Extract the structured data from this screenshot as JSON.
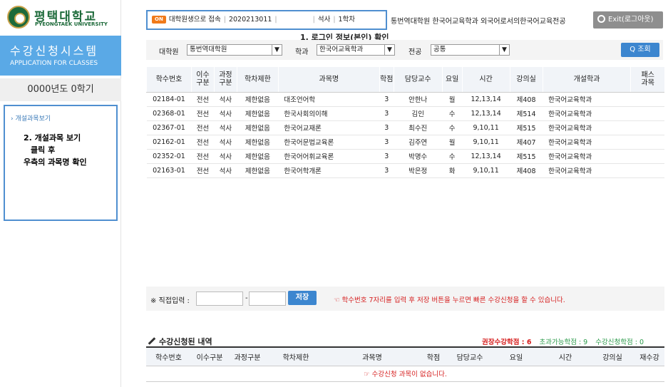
{
  "logo": {
    "korean": "평택대학교",
    "english": "PYEONGTAEK UNIVERSITY"
  },
  "sidebar": {
    "system_title": "수강신청시스템",
    "system_subtitle": "APPLICATION FOR CLASSES",
    "semester": "0000년도 0학기",
    "menu_item": "› 개설과목보기",
    "callout": [
      "2. 개설과목 보기",
      "클릭 후",
      "우측의 과목명 확인"
    ]
  },
  "header": {
    "on_badge": "ON",
    "access_type": "대학원생으로 접속",
    "student_id": "2020213011",
    "degree": "석사",
    "grade": "1학차",
    "department_line": "통번역대학원 한국어교육학과 외국어로서의한국어교육전공",
    "exit_label": "Exit(로그아웃)",
    "callout": "1. 로그인 정보(본인) 확인"
  },
  "filter": {
    "graduate_label": "대학원",
    "graduate_value": "통번역대학원",
    "dept_label": "학과",
    "dept_value": "한국어교육학과",
    "major_label": "전공",
    "major_value": "공통",
    "search_label": "Q 조회"
  },
  "table": {
    "headers": [
      "학수번호",
      "이수\n구분",
      "과정\n구분",
      "학차제한",
      "과목명",
      "학점",
      "담당교수",
      "요일",
      "시간",
      "강의실",
      "개설학과",
      "패스\n과목"
    ],
    "rows": [
      [
        "02184-01",
        "전선",
        "석사",
        "제한없음",
        "대조언어학",
        "3",
        "안한나",
        "월",
        "12,13,14",
        "제408",
        "한국어교육학과",
        ""
      ],
      [
        "02368-01",
        "전선",
        "석사",
        "제한없음",
        "한국사회의이해",
        "3",
        "김인",
        "수",
        "12,13,14",
        "제514",
        "한국어교육학과",
        ""
      ],
      [
        "02367-01",
        "전선",
        "석사",
        "제한없음",
        "한국어교재론",
        "3",
        "최수진",
        "수",
        "9,10,11",
        "제515",
        "한국어교육학과",
        ""
      ],
      [
        "02162-01",
        "전선",
        "석사",
        "제한없음",
        "한국어문법교육론",
        "3",
        "김주연",
        "월",
        "9,10,11",
        "제407",
        "한국어교육학과",
        ""
      ],
      [
        "02352-01",
        "전선",
        "석사",
        "제한없음",
        "한국어어휘교육론",
        "3",
        "박명수",
        "수",
        "12,13,14",
        "제515",
        "한국어교육학과",
        ""
      ],
      [
        "02163-01",
        "전선",
        "석사",
        "제한없음",
        "한국어학개론",
        "3",
        "박은정",
        "화",
        "9,10,11",
        "제408",
        "한국어교육학과",
        ""
      ]
    ]
  },
  "direct_input": {
    "label": "※ 직접입력 :",
    "dash": "-",
    "save_label": "저장",
    "note": "☜ 학수번호 7자리를 입력 후 저장 버튼을 누르면 빠른 수강신청을 할 수 있습니다."
  },
  "registered": {
    "title": "수강신청된 내역",
    "recommended": "권장수강학점 : 6",
    "over_available": "초과가능학점 : 9",
    "registered_credits": "수강신청학점 : 0",
    "headers": [
      "학수번호",
      "이수구분",
      "과정구분",
      "학차제한",
      "과목명",
      "학점",
      "담당교수",
      "요일",
      "시간",
      "강의실",
      "재수강"
    ],
    "empty_message": "☞ 수강신청 과목이 없습니다."
  },
  "colors": {
    "accent_blue": "#4f8fd0",
    "sidebar_blue": "#5aa9e6",
    "brand_green": "#1d6a3a",
    "warning_red": "#d62020"
  }
}
